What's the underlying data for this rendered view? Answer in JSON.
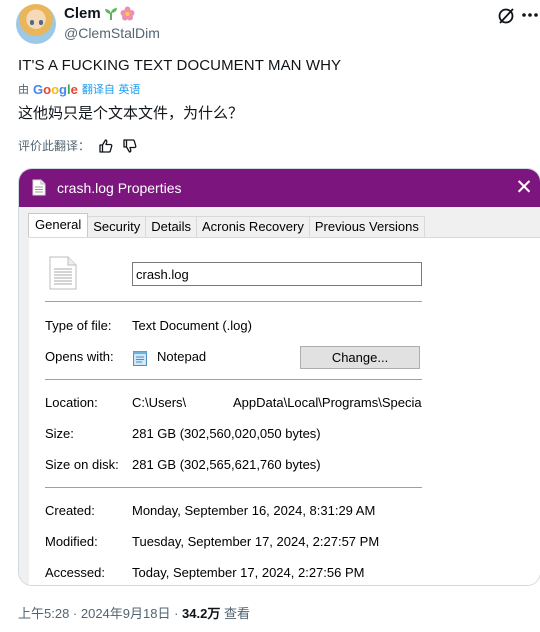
{
  "tweet": {
    "author": {
      "display_name": "Clem",
      "handle": "@ClemStalDim",
      "name_emojis": [
        "sprout-emoji",
        "flower-emoji"
      ]
    },
    "text": "IT'S A FUCKING TEXT DOCUMENT MAN WHY",
    "translation": {
      "by": "由",
      "provider": "Google",
      "link_label": "翻译自 英语",
      "text": "这他妈只是个文本文件，为什么？",
      "rate_label": "评价此翻译："
    },
    "footer": {
      "time_date": "上午5:28 · 2024年9月18日 · ",
      "views_count": "34.2万",
      "views_label": " 查看"
    }
  },
  "dialog": {
    "title": "crash.log Properties",
    "close_icon": "close-icon",
    "accent_color": "#7d157f",
    "tabs": [
      "General",
      "Security",
      "Details",
      "Acronis Recovery",
      "Previous Versions"
    ],
    "active_tab": "General",
    "file_name": "crash.log",
    "fields": {
      "type_label": "Type of file:",
      "type_value": "Text Document (.log)",
      "opens_label": "Opens with:",
      "opens_value": "Notepad",
      "change_button": "Change...",
      "location_label": "Location:",
      "location_value_start": "C:\\Users\\",
      "location_value_end": "AppData\\Local\\Programs\\Specia",
      "size_label": "Size:",
      "size_value": "281 GB (302,560,020,050 bytes)",
      "size_on_disk_label": "Size on disk:",
      "size_on_disk_value": "281 GB (302,565,621,760 bytes)",
      "created_label": "Created:",
      "created_value": "Monday, September 16, 2024, 8:31:29 AM",
      "modified_label": "Modified:",
      "modified_value": "Tuesday, September 17, 2024, 2:27:57 PM",
      "accessed_label": "Accessed:",
      "accessed_value": "Today, September 17, 2024, 2:27:56 PM"
    }
  }
}
